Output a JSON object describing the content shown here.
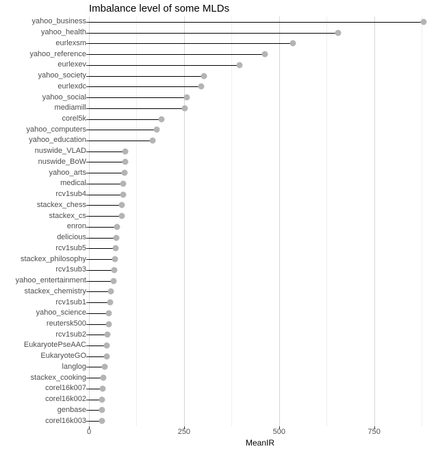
{
  "chart_data": {
    "type": "bar",
    "title": "Imbalance level of some MLDs",
    "xlabel": "MeanIR",
    "ylabel": "",
    "xlim": [
      0,
      900
    ],
    "xticks": [
      0,
      250,
      500,
      750
    ],
    "categories": [
      "yahoo_business",
      "yahoo_health",
      "eurlexsm",
      "yahoo_reference",
      "eurlexev",
      "yahoo_society",
      "eurlexdc",
      "yahoo_social",
      "mediamill",
      "corel5k",
      "yahoo_computers",
      "yahoo_education",
      "nuswide_VLAD",
      "nuswide_BoW",
      "yahoo_arts",
      "medical",
      "rcv1sub4",
      "stackex_chess",
      "stackex_cs",
      "enron",
      "delicious",
      "rcv1sub5",
      "stackex_philosophy",
      "rcv1sub3",
      "yahoo_entertainment",
      "stackex_chemistry",
      "rcv1sub1",
      "yahoo_science",
      "reutersk500",
      "rcv1sub2",
      "EukaryotePseAAC",
      "EukaryoteGO",
      "langlog",
      "stackex_cooking",
      "corel16k007",
      "corel16k002",
      "genbase",
      "corel16k003"
    ],
    "values": [
      880,
      655,
      537,
      462,
      396,
      303,
      295,
      258,
      252,
      190,
      178,
      168,
      96,
      95,
      94,
      90,
      90,
      86,
      86,
      74,
      72,
      70,
      68,
      66,
      64,
      58,
      55,
      52,
      52,
      48,
      46,
      46,
      42,
      38,
      36,
      35,
      34,
      34
    ]
  }
}
